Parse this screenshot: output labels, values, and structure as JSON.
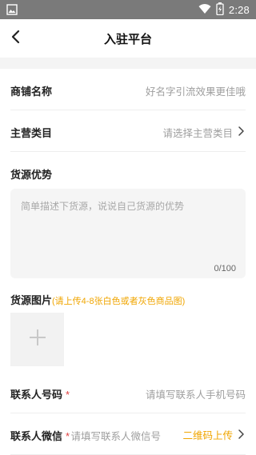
{
  "status_bar": {
    "time": "2:28",
    "icons": [
      "image-icon",
      "wifi-icon",
      "battery-icon"
    ]
  },
  "navbar": {
    "title": "入驻平台",
    "back_icon": "chevron-left-icon"
  },
  "form": {
    "shop_name": {
      "label": "商铺名称",
      "placeholder": "好名字引流效果更佳哦"
    },
    "category": {
      "label": "主营类目",
      "placeholder": "请选择主营类目"
    },
    "advantage": {
      "label": "货源优势",
      "placeholder": "简单描述下货源，说说自己货源的优势",
      "counter": "0/100"
    },
    "images": {
      "label": "货源图片",
      "hint": "(请上传4-8张白色或者灰色商品图)"
    },
    "phone": {
      "label": "联系人号码",
      "required_mark": "*",
      "placeholder": "请填写联系人手机号码"
    },
    "wechat": {
      "label": "联系人微信",
      "required_mark": "*",
      "placeholder": "请填写联系人微信号",
      "qr_upload": "二维码上传"
    }
  },
  "colors": {
    "accent": "#f0a500",
    "required": "#e04040",
    "status_bar": "#7a7a7a",
    "placeholder": "#9e9e9e"
  }
}
